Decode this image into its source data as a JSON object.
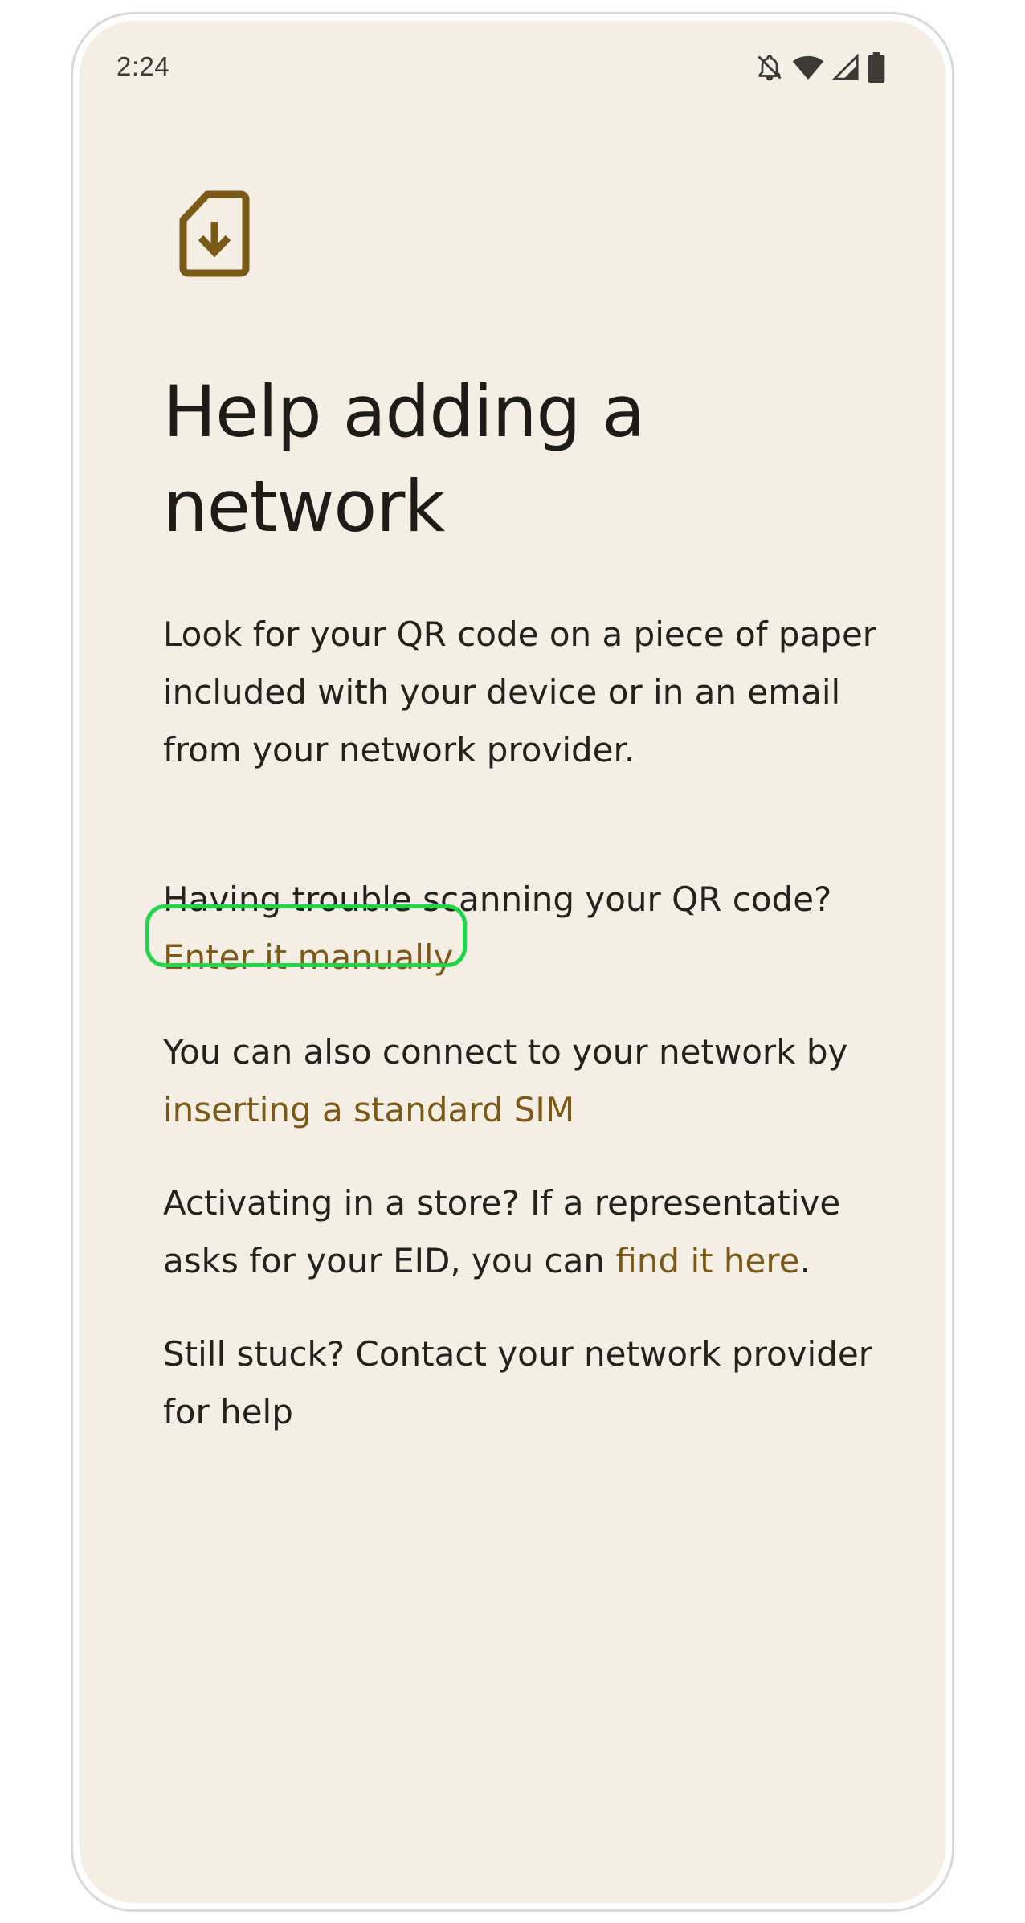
{
  "status_bar": {
    "time": "2:24",
    "icons": [
      "notifications-off-icon",
      "wifi-icon",
      "cellular-signal-icon",
      "battery-icon"
    ]
  },
  "page": {
    "icon": "esim-download-icon",
    "title": "Help adding a network",
    "intro": "Look for your QR code on a piece of paper included with your device or in an email from your network provider.",
    "trouble_text": "Having trouble scanning your QR code?",
    "manual_link": "Enter it manually",
    "sim_text": "You can also connect to your network by",
    "sim_link": "inserting a standard SIM",
    "store_text": "Activating in a store? If a representative asks for your EID, you can",
    "eid_link": "find it here",
    "store_text_end": ".",
    "stuck_text": "Still stuck? Contact your network provider for help"
  },
  "colors": {
    "background": "#f4eee5",
    "accent": "#7a5a16",
    "highlight": "#1fd64a"
  }
}
